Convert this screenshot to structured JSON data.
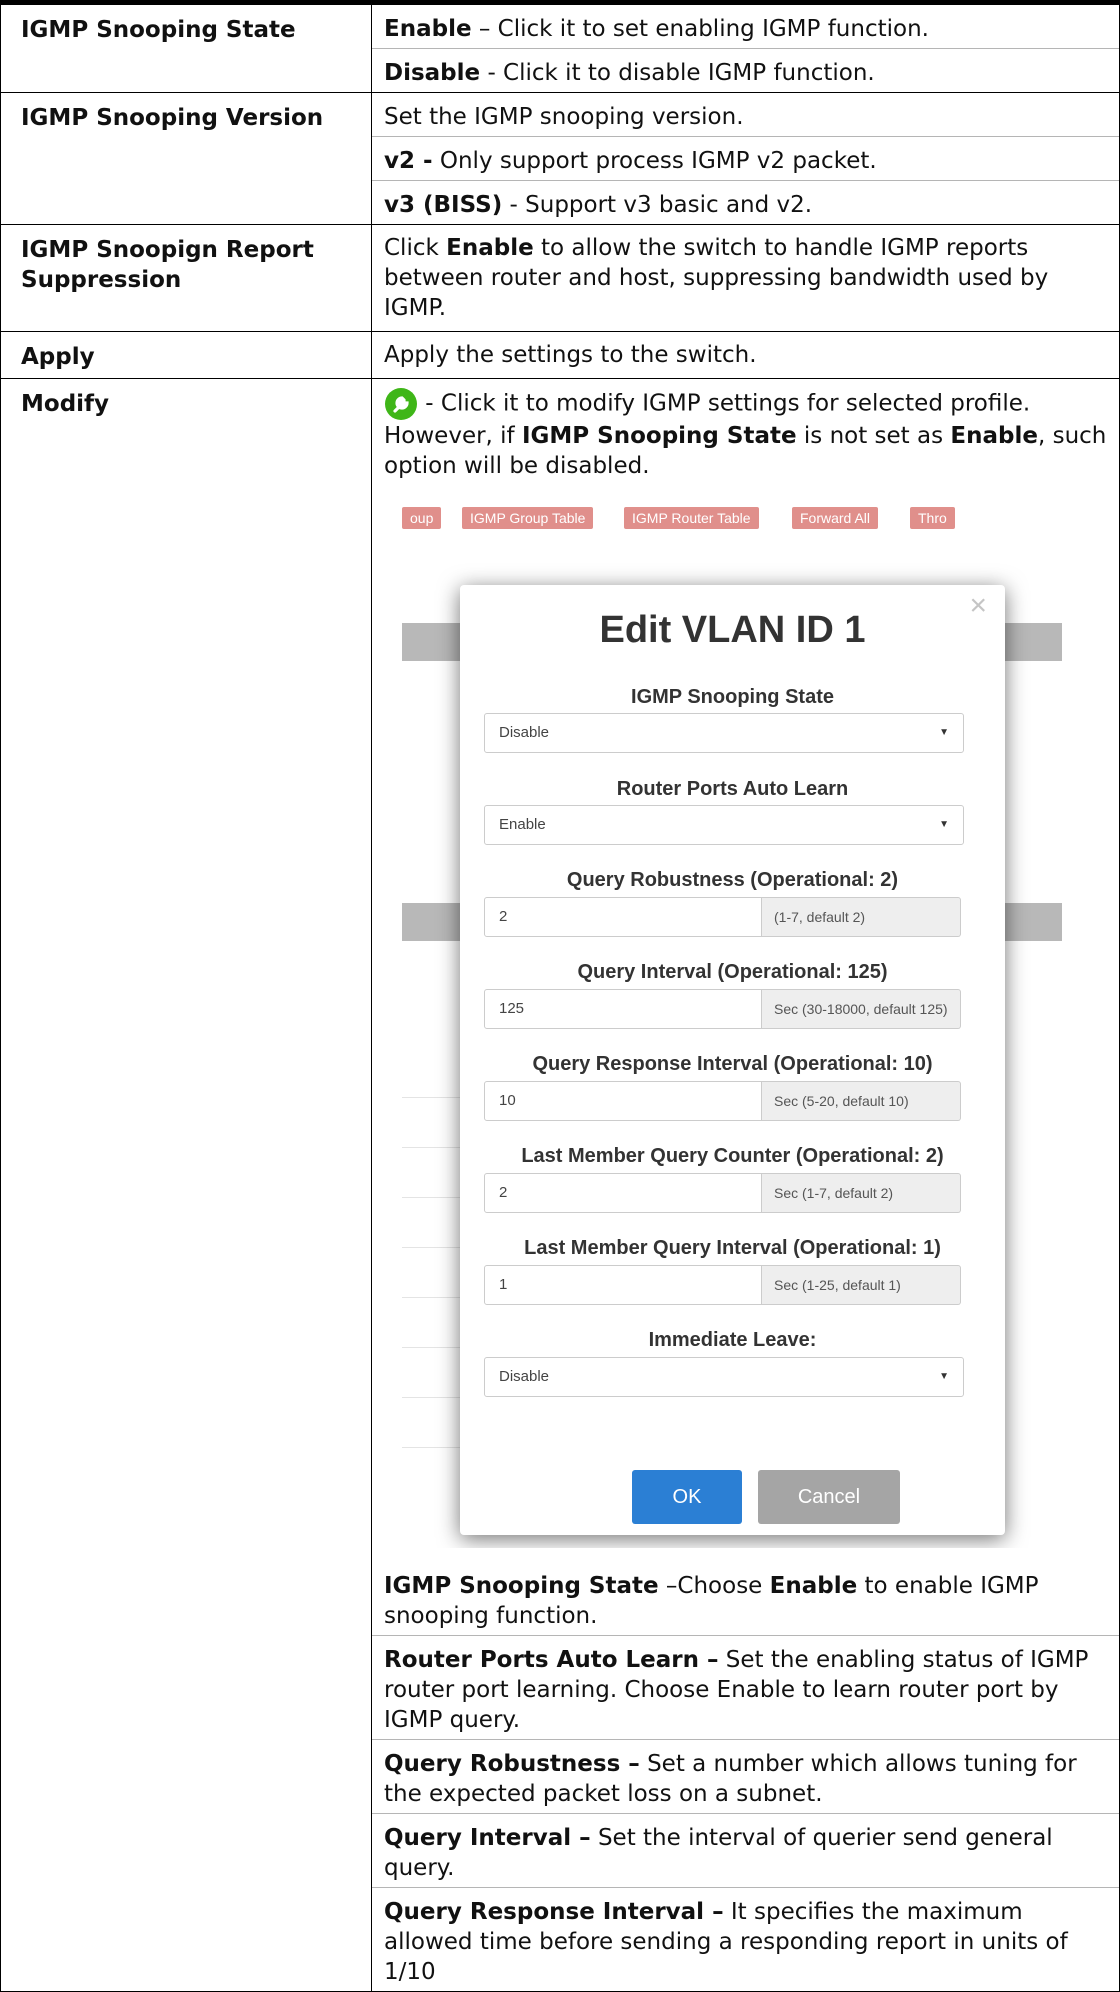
{
  "rows": {
    "state": {
      "label": "IGMP Snooping State",
      "l1_bold": "Enable",
      "l1_text": " – Click it to set enabling IGMP function.",
      "l2_bold": "Disable",
      "l2_text": " - Click it to disable IGMP function."
    },
    "version": {
      "label": "IGMP Snooping Version",
      "l1_text": "Set the IGMP snooping version.",
      "l2_bold": "v2 -",
      "l2_text": " Only support process IGMP v2 packet.",
      "l3_bold": "v3 (BISS)",
      "l3_text": " - Support v3 basic and v2."
    },
    "suppression": {
      "label": "IGMP Snoopign Report Suppression",
      "t1": "Click ",
      "b1": "Enable",
      "t2": " to allow the switch to handle IGMP reports between router and host, suppressing bandwidth used by IGMP."
    },
    "apply": {
      "label": "Apply",
      "text": "Apply the settings to the switch."
    },
    "modify": {
      "label": "Modify",
      "intro1": " - Click it to modify IGMP settings for selected profile. However, if ",
      "intro_b1": "IGMP Snooping State",
      "intro2": " is not set as ",
      "intro_b2": "Enable",
      "intro3": ", such option will be disabled.",
      "d1_b": "IGMP Snooping State",
      "d1_t1": " –Choose ",
      "d1_b2": "Enable",
      "d1_t2": " to enable IGMP snooping function.",
      "d2_b": "Router Ports Auto Learn –",
      "d2_t": " Set the enabling status of IGMP router port learning. Choose Enable to learn router port by IGMP query.",
      "d3_b": "Query Robustness –",
      "d3_t": " Set a number which allows tuning for the expected packet loss on a subnet.",
      "d4_b": "Query Interval –",
      "d4_t": " Set the interval of querier send general query.",
      "d5_b": "Query Response Interval –",
      "d5_t": " It specifies the maximum allowed time before sending a responding report in units of 1/10"
    }
  },
  "dialog": {
    "bg_tabs": [
      "oup",
      "IGMP Group Table",
      "IGMP Router Table",
      "Forward All",
      "Thro"
    ],
    "title": "Edit VLAN ID 1",
    "close": "×",
    "fields": {
      "state_label": "IGMP Snooping State",
      "state_value": "Disable",
      "autolearn_label": "Router Ports Auto Learn",
      "autolearn_value": "Enable",
      "robust_label": "Query Robustness (Operational: 2)",
      "robust_value": "2",
      "robust_hint": "(1-7, default 2)",
      "qint_label": "Query Interval (Operational: 125)",
      "qint_value": "125",
      "qint_hint": "Sec (30-18000, default 125)",
      "qresp_label": "Query Response Interval (Operational: 10)",
      "qresp_value": "10",
      "qresp_hint": "Sec (5-20, default 10)",
      "lmqc_label": "Last Member Query Counter (Operational: 2)",
      "lmqc_value": "2",
      "lmqc_hint": "Sec (1-7, default 2)",
      "lmqi_label": "Last Member Query Interval (Operational: 1)",
      "lmqi_value": "1",
      "lmqi_hint": "Sec (1-25, default 1)",
      "leave_label": "Immediate Leave:",
      "leave_value": "Disable"
    },
    "ok": "OK",
    "cancel": "Cancel",
    "colors": {
      "ok": "#2b7fd4",
      "cancel": "#a5a5a5",
      "icon": "#3fb618"
    }
  }
}
